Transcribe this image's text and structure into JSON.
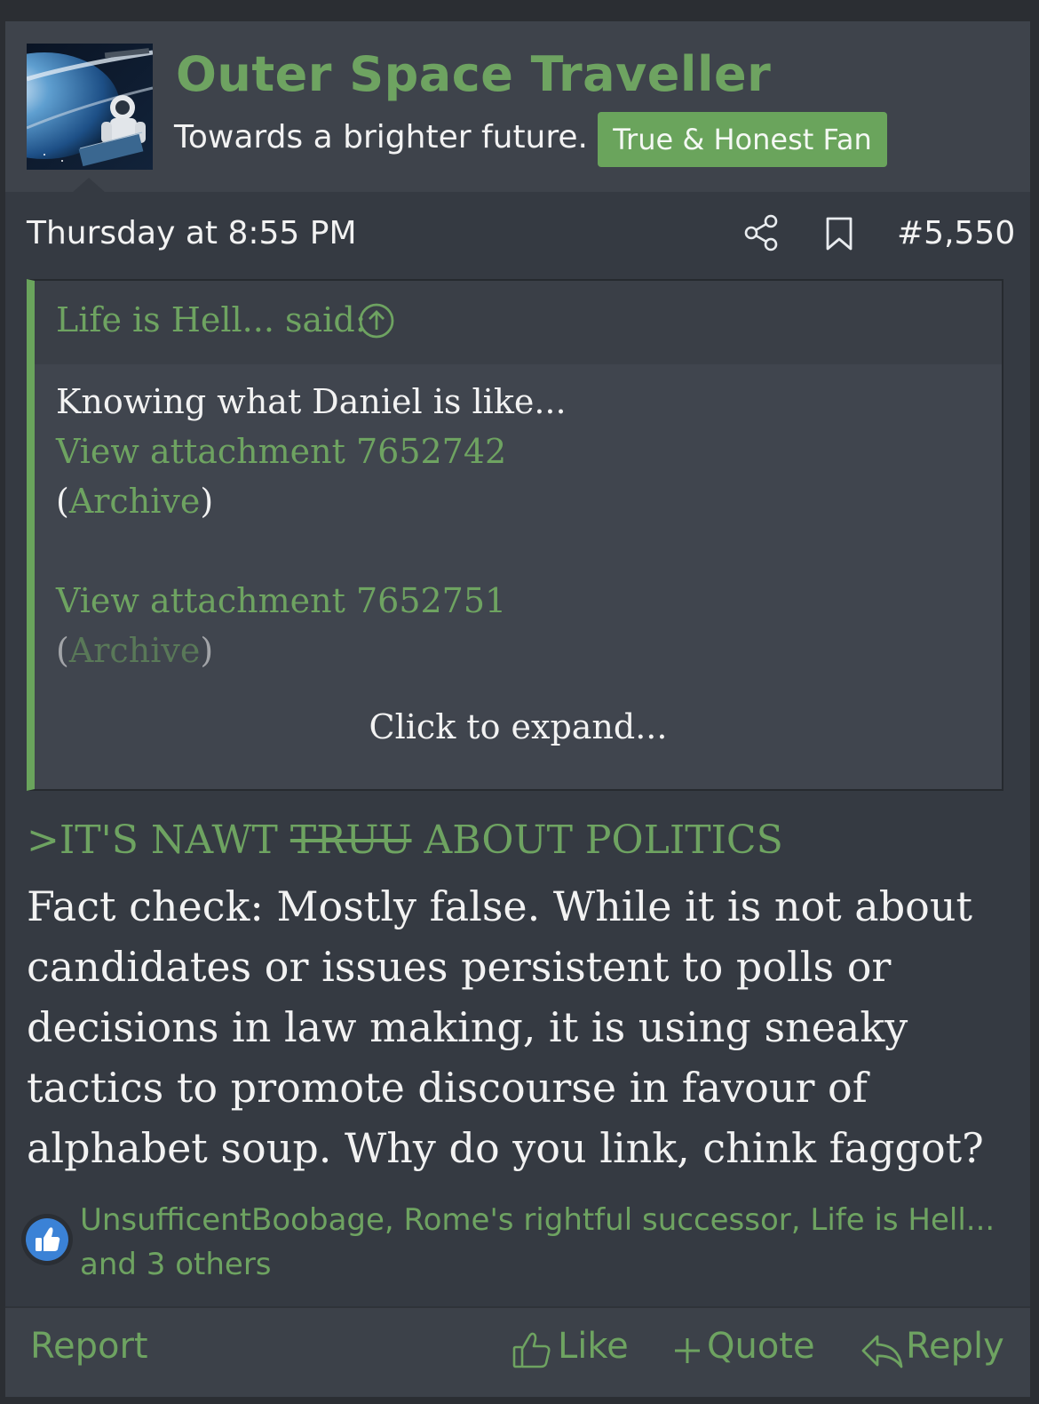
{
  "user": {
    "name": "Outer Space Traveller",
    "title": "Towards a brighter future.",
    "banner": "True & Honest Fan"
  },
  "post": {
    "date": "Thursday at 8:55 PM",
    "number": "#5,550"
  },
  "quote": {
    "author": "Life is Hell... said:",
    "text": "Knowing what Daniel is like...",
    "attachment1": "View attachment 7652742",
    "archive1": "Archive",
    "attachment2": "View attachment 7652751",
    "archive2": "Archive",
    "expand": "Click to expand..."
  },
  "message": {
    "greentext_prefix": ">IT'S NAWT ",
    "greentext_strike": "TRUU",
    "greentext_suffix": " ABOUT POLITICS",
    "body": "Fact check: Mostly false. While it is not about candidates or issues persistent to polls or decisions in law making, it is using sneaky tactics to promote discourse in favour of alphabet soup. Why do you link, chink faggot?"
  },
  "reactions": {
    "text": "UnsufficentBoobage, Rome's rightful successor, Life is Hell... and 3 others",
    "icon": "thumbs-up-icon"
  },
  "footer": {
    "report": "Report",
    "like": "Like",
    "quote": "Quote",
    "reply": "Reply"
  },
  "colors": {
    "accent": "#6aa45c",
    "background": "#353a42",
    "text": "#f2f2f2",
    "like_blue": "#3b82d6"
  }
}
